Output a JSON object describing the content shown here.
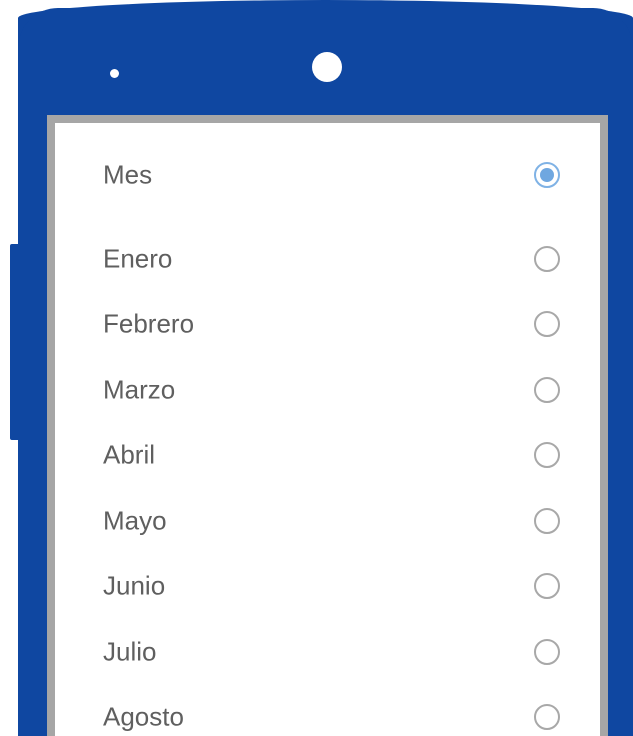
{
  "picker": {
    "header": {
      "label": "Mes",
      "selected": true
    },
    "items": [
      {
        "label": "Enero",
        "selected": false
      },
      {
        "label": "Febrero",
        "selected": false
      },
      {
        "label": "Marzo",
        "selected": false
      },
      {
        "label": "Abril",
        "selected": false
      },
      {
        "label": "Mayo",
        "selected": false
      },
      {
        "label": "Junio",
        "selected": false
      },
      {
        "label": "Julio",
        "selected": false
      },
      {
        "label": "Agosto",
        "selected": false
      }
    ]
  },
  "colors": {
    "phone_frame": "#0f47a1",
    "screen_border": "#a6a6a6",
    "label_text": "#5f5f5f",
    "radio_selected": "#6fa7e0",
    "radio_unselected": "#a8a8a8"
  }
}
